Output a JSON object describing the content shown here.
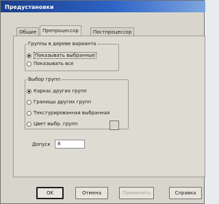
{
  "window": {
    "title": "Предустановки"
  },
  "tabs": [
    {
      "label": "Общие",
      "active": false
    },
    {
      "label": "Препроцессор",
      "active": true
    },
    {
      "label": "Постпроцессор",
      "active": false
    }
  ],
  "group_tree": {
    "legend": "Группы в дереве варианта",
    "options": [
      {
        "label": "Показывать выбранные",
        "selected": true
      },
      {
        "label": "Показывать все",
        "selected": false
      }
    ]
  },
  "group_select": {
    "legend": "Выбор групп",
    "options": [
      {
        "label": "Каркас других групп",
        "selected": true
      },
      {
        "label": "Границы других групп",
        "selected": false
      },
      {
        "label": "Текстурированная выбранная",
        "selected": false
      },
      {
        "label": "Цвет выбр. групп",
        "selected": false
      }
    ]
  },
  "tolerance": {
    "label": "Допуск",
    "value": "8"
  },
  "buttons": {
    "ok": "OK",
    "cancel": "Отмена",
    "apply": "Применить",
    "help": "Справка"
  }
}
